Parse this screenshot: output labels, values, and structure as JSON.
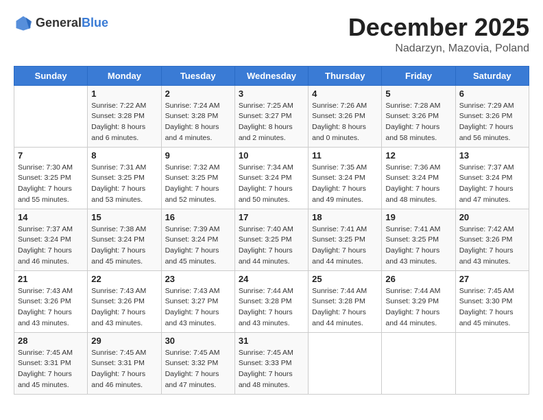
{
  "header": {
    "logo_general": "General",
    "logo_blue": "Blue",
    "title": "December 2025",
    "location": "Nadarzyn, Mazovia, Poland"
  },
  "weekdays": [
    "Sunday",
    "Monday",
    "Tuesday",
    "Wednesday",
    "Thursday",
    "Friday",
    "Saturday"
  ],
  "weeks": [
    [
      {
        "day": "",
        "sunrise": "",
        "sunset": "",
        "daylight": ""
      },
      {
        "day": "1",
        "sunrise": "Sunrise: 7:22 AM",
        "sunset": "Sunset: 3:28 PM",
        "daylight": "Daylight: 8 hours and 6 minutes."
      },
      {
        "day": "2",
        "sunrise": "Sunrise: 7:24 AM",
        "sunset": "Sunset: 3:28 PM",
        "daylight": "Daylight: 8 hours and 4 minutes."
      },
      {
        "day": "3",
        "sunrise": "Sunrise: 7:25 AM",
        "sunset": "Sunset: 3:27 PM",
        "daylight": "Daylight: 8 hours and 2 minutes."
      },
      {
        "day": "4",
        "sunrise": "Sunrise: 7:26 AM",
        "sunset": "Sunset: 3:26 PM",
        "daylight": "Daylight: 8 hours and 0 minutes."
      },
      {
        "day": "5",
        "sunrise": "Sunrise: 7:28 AM",
        "sunset": "Sunset: 3:26 PM",
        "daylight": "Daylight: 7 hours and 58 minutes."
      },
      {
        "day": "6",
        "sunrise": "Sunrise: 7:29 AM",
        "sunset": "Sunset: 3:26 PM",
        "daylight": "Daylight: 7 hours and 56 minutes."
      }
    ],
    [
      {
        "day": "7",
        "sunrise": "Sunrise: 7:30 AM",
        "sunset": "Sunset: 3:25 PM",
        "daylight": "Daylight: 7 hours and 55 minutes."
      },
      {
        "day": "8",
        "sunrise": "Sunrise: 7:31 AM",
        "sunset": "Sunset: 3:25 PM",
        "daylight": "Daylight: 7 hours and 53 minutes."
      },
      {
        "day": "9",
        "sunrise": "Sunrise: 7:32 AM",
        "sunset": "Sunset: 3:25 PM",
        "daylight": "Daylight: 7 hours and 52 minutes."
      },
      {
        "day": "10",
        "sunrise": "Sunrise: 7:34 AM",
        "sunset": "Sunset: 3:24 PM",
        "daylight": "Daylight: 7 hours and 50 minutes."
      },
      {
        "day": "11",
        "sunrise": "Sunrise: 7:35 AM",
        "sunset": "Sunset: 3:24 PM",
        "daylight": "Daylight: 7 hours and 49 minutes."
      },
      {
        "day": "12",
        "sunrise": "Sunrise: 7:36 AM",
        "sunset": "Sunset: 3:24 PM",
        "daylight": "Daylight: 7 hours and 48 minutes."
      },
      {
        "day": "13",
        "sunrise": "Sunrise: 7:37 AM",
        "sunset": "Sunset: 3:24 PM",
        "daylight": "Daylight: 7 hours and 47 minutes."
      }
    ],
    [
      {
        "day": "14",
        "sunrise": "Sunrise: 7:37 AM",
        "sunset": "Sunset: 3:24 PM",
        "daylight": "Daylight: 7 hours and 46 minutes."
      },
      {
        "day": "15",
        "sunrise": "Sunrise: 7:38 AM",
        "sunset": "Sunset: 3:24 PM",
        "daylight": "Daylight: 7 hours and 45 minutes."
      },
      {
        "day": "16",
        "sunrise": "Sunrise: 7:39 AM",
        "sunset": "Sunset: 3:24 PM",
        "daylight": "Daylight: 7 hours and 45 minutes."
      },
      {
        "day": "17",
        "sunrise": "Sunrise: 7:40 AM",
        "sunset": "Sunset: 3:25 PM",
        "daylight": "Daylight: 7 hours and 44 minutes."
      },
      {
        "day": "18",
        "sunrise": "Sunrise: 7:41 AM",
        "sunset": "Sunset: 3:25 PM",
        "daylight": "Daylight: 7 hours and 44 minutes."
      },
      {
        "day": "19",
        "sunrise": "Sunrise: 7:41 AM",
        "sunset": "Sunset: 3:25 PM",
        "daylight": "Daylight: 7 hours and 43 minutes."
      },
      {
        "day": "20",
        "sunrise": "Sunrise: 7:42 AM",
        "sunset": "Sunset: 3:26 PM",
        "daylight": "Daylight: 7 hours and 43 minutes."
      }
    ],
    [
      {
        "day": "21",
        "sunrise": "Sunrise: 7:43 AM",
        "sunset": "Sunset: 3:26 PM",
        "daylight": "Daylight: 7 hours and 43 minutes."
      },
      {
        "day": "22",
        "sunrise": "Sunrise: 7:43 AM",
        "sunset": "Sunset: 3:26 PM",
        "daylight": "Daylight: 7 hours and 43 minutes."
      },
      {
        "day": "23",
        "sunrise": "Sunrise: 7:43 AM",
        "sunset": "Sunset: 3:27 PM",
        "daylight": "Daylight: 7 hours and 43 minutes."
      },
      {
        "day": "24",
        "sunrise": "Sunrise: 7:44 AM",
        "sunset": "Sunset: 3:28 PM",
        "daylight": "Daylight: 7 hours and 43 minutes."
      },
      {
        "day": "25",
        "sunrise": "Sunrise: 7:44 AM",
        "sunset": "Sunset: 3:28 PM",
        "daylight": "Daylight: 7 hours and 44 minutes."
      },
      {
        "day": "26",
        "sunrise": "Sunrise: 7:44 AM",
        "sunset": "Sunset: 3:29 PM",
        "daylight": "Daylight: 7 hours and 44 minutes."
      },
      {
        "day": "27",
        "sunrise": "Sunrise: 7:45 AM",
        "sunset": "Sunset: 3:30 PM",
        "daylight": "Daylight: 7 hours and 45 minutes."
      }
    ],
    [
      {
        "day": "28",
        "sunrise": "Sunrise: 7:45 AM",
        "sunset": "Sunset: 3:31 PM",
        "daylight": "Daylight: 7 hours and 45 minutes."
      },
      {
        "day": "29",
        "sunrise": "Sunrise: 7:45 AM",
        "sunset": "Sunset: 3:31 PM",
        "daylight": "Daylight: 7 hours and 46 minutes."
      },
      {
        "day": "30",
        "sunrise": "Sunrise: 7:45 AM",
        "sunset": "Sunset: 3:32 PM",
        "daylight": "Daylight: 7 hours and 47 minutes."
      },
      {
        "day": "31",
        "sunrise": "Sunrise: 7:45 AM",
        "sunset": "Sunset: 3:33 PM",
        "daylight": "Daylight: 7 hours and 48 minutes."
      },
      {
        "day": "",
        "sunrise": "",
        "sunset": "",
        "daylight": ""
      },
      {
        "day": "",
        "sunrise": "",
        "sunset": "",
        "daylight": ""
      },
      {
        "day": "",
        "sunrise": "",
        "sunset": "",
        "daylight": ""
      }
    ]
  ]
}
